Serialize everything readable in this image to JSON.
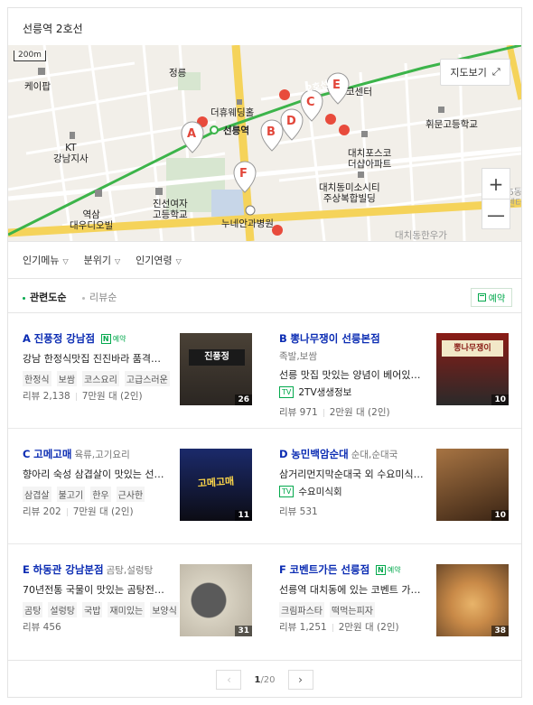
{
  "header": {
    "title": "선릉역 2호선"
  },
  "map": {
    "scale": "200m",
    "line_label": "2호선",
    "labels": {
      "kepab": "케이팝",
      "jeongreung": "정릉",
      "kt": "KT\n강남지사",
      "theheu": "더휴웨딩홀",
      "station": "선릉역",
      "cocenter": "코센터",
      "hwimun": "휘문고등학교",
      "daechipos": "대치포스코\n더샵아파트",
      "daechidong": "대치동미소시티\n주상복합빌딩",
      "jinseon": "진선여자\n고등학교",
      "yeokdae": "역삼\n대우디오빌",
      "nuneane": "누네안과병원",
      "daechi_bottom": "대치동한우가",
      "right_edge": "6동\n센터"
    },
    "markers": [
      "A",
      "B",
      "C",
      "D",
      "E",
      "F"
    ],
    "view_button": "지도보기",
    "zoom_in": "+",
    "zoom_out": "—",
    "colors": {
      "road": "#f5d35a",
      "subway": "#3cb44a",
      "marker": "#e2463a",
      "dot": "#e84b3c"
    }
  },
  "filters": [
    "인기메뉴",
    "분위기",
    "인기연령"
  ],
  "sort": {
    "options": [
      "관련도순",
      "리뷰순"
    ],
    "active": 0,
    "reserve_label": "예약"
  },
  "places": [
    {
      "letter": "A",
      "name": "진풍정 강남점",
      "category": "",
      "npay_label": "예약",
      "desc": "강남 한정식맛집 진진바라 품격…",
      "tags": [
        "한정식",
        "보쌈",
        "코스요리",
        "고급스러운"
      ],
      "reviews": "리뷰 2,138",
      "price": "7만원 대 (2인)",
      "photos": "26",
      "photo_colors": [
        "#4a4136",
        "#2b2622"
      ],
      "sign_text": "진풍정"
    },
    {
      "letter": "B",
      "name": "뽕나무쟁이 선릉본점",
      "category": "",
      "sub_category": "족발,보쌈",
      "npay_label": "",
      "desc": "선릉 맛집 맛있는 양념이 베어있…",
      "tv": "2TV생생정보",
      "tv_label": "TV",
      "reviews": "리뷰 971",
      "price": "2만원 대 (2인)",
      "photos": "10",
      "photo_colors": [
        "#8a1c16",
        "#2a2a2a"
      ],
      "sign_text": "뽕나무쟁이"
    },
    {
      "letter": "C",
      "name": "고메고매",
      "category": "육류,고기요리",
      "npay_label": "",
      "desc": "향아리 숙성 삼겹살이 맛있는 선…",
      "tags": [
        "삼겹살",
        "불고기",
        "한우",
        "근사한"
      ],
      "reviews": "리뷰 202",
      "price": "7만원 대 (2인)",
      "photos": "11",
      "photo_colors": [
        "#1b2a6b",
        "#0c0c14"
      ],
      "sign_text": "고메고매"
    },
    {
      "letter": "D",
      "name": "농민백암순대",
      "category": "순대,순대국",
      "npay_label": "",
      "desc": "삼거리먼지막순대국 외 수요미식…",
      "tv": "수요미식회",
      "tv_label": "TV",
      "reviews": "리뷰 531",
      "price": "",
      "photos": "10",
      "photo_colors": [
        "#7a5430",
        "#3a2414"
      ],
      "sign_text": ""
    },
    {
      "letter": "E",
      "name": "하동관 강남분점",
      "category": "곰탕,설렁탕",
      "npay_label": "",
      "desc": "70년전통 국물이 맛있는 곰탕전…",
      "tags": [
        "곰탕",
        "설렁탕",
        "국밥",
        "재미있는",
        "보양식"
      ],
      "reviews": "리뷰 456",
      "price": "",
      "photos": "31",
      "photo_colors": [
        "#c9c3b4",
        "#4a4a4a"
      ],
      "sign_text": ""
    },
    {
      "letter": "F",
      "name": "코벤트가든 선릉점",
      "category": "",
      "npay_label": "예약",
      "desc": "선릉역 대치동에 있는 코벤트 가…",
      "tags": [
        "크림파스타",
        "떡먹는피자"
      ],
      "reviews": "리뷰 1,251",
      "price": "2만원 대 (2인)",
      "photos": "38",
      "photo_colors": [
        "#d49a5a",
        "#6d4a2a"
      ],
      "sign_text": ""
    }
  ],
  "pager": {
    "current": "1",
    "total": "/20",
    "prev": "‹",
    "next": "›"
  }
}
